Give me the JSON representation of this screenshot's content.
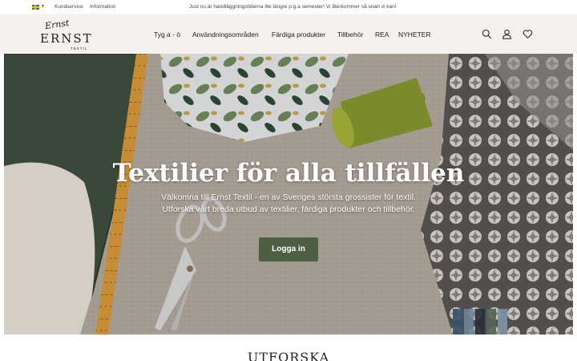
{
  "topbar": {
    "language_flag": "swedish-flag-icon",
    "links": [
      "Kundservice",
      "Information"
    ],
    "notice": "Just nu är handläggningstiderna lite längre p.g.a semester! Vi återkommer så snart vi kan!"
  },
  "header": {
    "logo": {
      "script": "Ernst",
      "word": "ERNST",
      "sub": "TEXTIL"
    },
    "nav": [
      "Tyg a - ö",
      "Användningsområden",
      "Färdiga produkter",
      "Tillbehör",
      "REA",
      "NYHETER"
    ],
    "icons": [
      "search-icon",
      "user-icon",
      "heart-icon"
    ]
  },
  "hero": {
    "title": "Textilier för alla tillfällen",
    "subtitle_line1": "Välkomna till Ernst Textil - en av Sveriges största grossister för textil.",
    "subtitle_line2": "Utforska vårt breda utbud av textilier, färdiga produkter och tillbehör.",
    "button_label": "Logga in",
    "button_color": "#4f5f43"
  },
  "section": {
    "title": "UTFORSKA"
  }
}
